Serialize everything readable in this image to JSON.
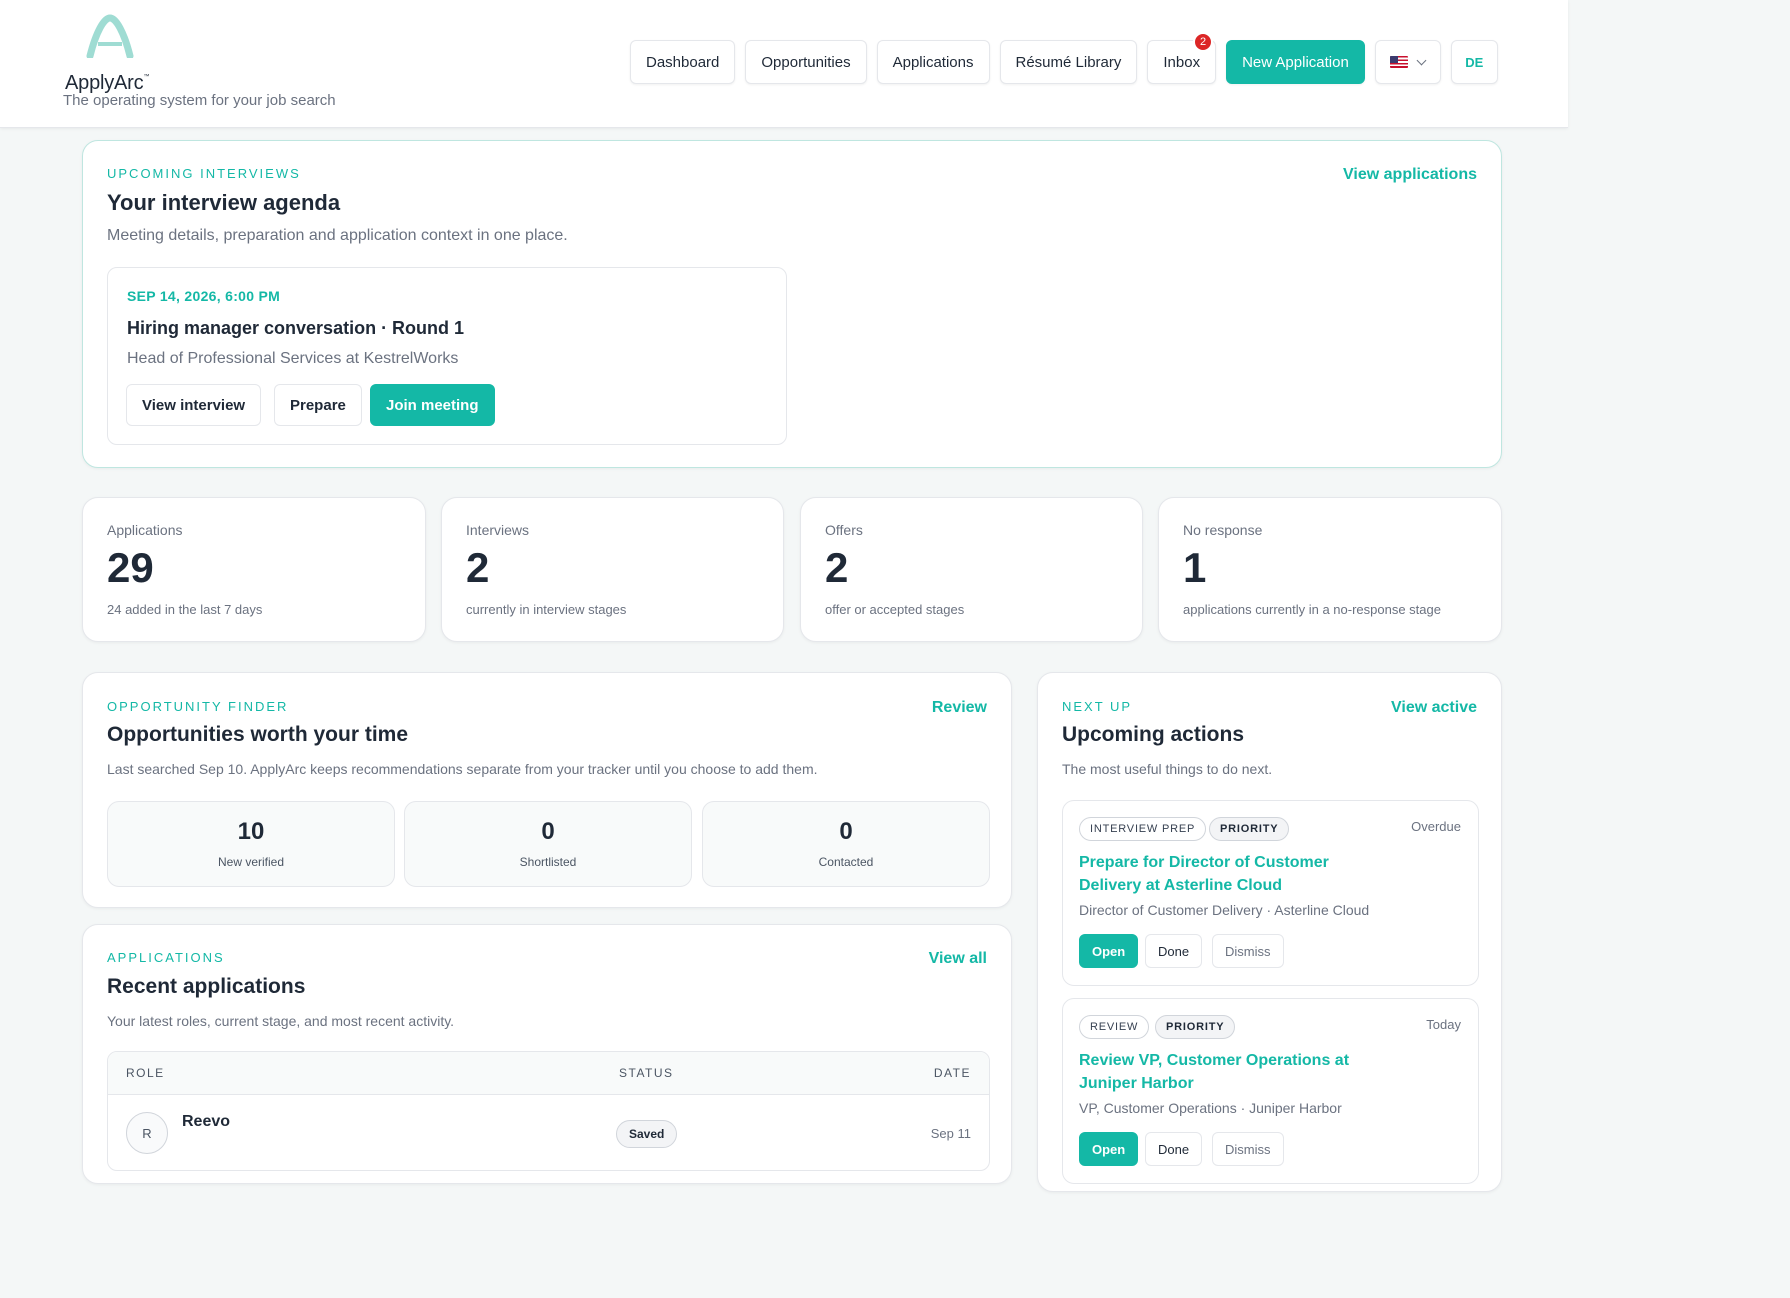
{
  "brand": {
    "name": "ApplyArc",
    "tm": "™",
    "tagline": "The operating system for your job search"
  },
  "nav": {
    "dashboard": "Dashboard",
    "opportunities": "Opportunities",
    "applications": "Applications",
    "resume_library": "Résumé Library",
    "inbox": "Inbox",
    "inbox_count": "2",
    "new_application": "New Application",
    "language_flag": "flag-us-icon",
    "avatar_initials": "DE"
  },
  "interviews": {
    "eyebrow": "UPCOMING INTERVIEWS",
    "title": "Your interview agenda",
    "subtitle": "Meeting details, preparation and application context in one place.",
    "link": "View applications",
    "item": {
      "datetime": "SEP 14, 2026, 6:00 PM",
      "title": "Hiring manager conversation · Round 1",
      "subtitle": "Head of Professional Services at KestrelWorks",
      "view_label": "View interview",
      "prepare_label": "Prepare",
      "join_label": "Join meeting"
    }
  },
  "stats": [
    {
      "label": "Applications",
      "value": "29",
      "note": "24 added in the last 7 days"
    },
    {
      "label": "Interviews",
      "value": "2",
      "note": "currently in interview stages"
    },
    {
      "label": "Offers",
      "value": "2",
      "note": "offer or accepted stages"
    },
    {
      "label": "No response",
      "value": "1",
      "note": "applications currently in a no-response stage"
    }
  ],
  "finder": {
    "eyebrow": "OPPORTUNITY FINDER",
    "title": "Opportunities worth your time",
    "subtitle": "Last searched Sep 10. ApplyArc keeps recommendations separate from your tracker until you choose to add them.",
    "link": "Review",
    "metrics": [
      {
        "value": "10",
        "label": "New verified"
      },
      {
        "value": "0",
        "label": "Shortlisted"
      },
      {
        "value": "0",
        "label": "Contacted"
      }
    ]
  },
  "next_up": {
    "eyebrow": "NEXT UP",
    "title": "Upcoming actions",
    "subtitle": "The most useful things to do next.",
    "link": "View active",
    "actions": [
      {
        "tag": "INTERVIEW PREP",
        "priority": "PRIORITY",
        "due": "Overdue",
        "title": "Prepare for Director of Customer Delivery at Asterline Cloud",
        "subtitle": "Director of Customer Delivery · Asterline Cloud",
        "open": "Open",
        "done": "Done",
        "dismiss": "Dismiss"
      },
      {
        "tag": "REVIEW",
        "priority": "PRIORITY",
        "due": "Today",
        "title": "Review VP, Customer Operations at Juniper Harbor",
        "subtitle": "VP, Customer Operations · Juniper Harbor",
        "open": "Open",
        "done": "Done",
        "dismiss": "Dismiss"
      }
    ]
  },
  "recent": {
    "eyebrow": "APPLICATIONS",
    "title": "Recent applications",
    "subtitle": "Your latest roles, current stage, and most recent activity.",
    "link": "View all",
    "columns": {
      "role": "ROLE",
      "status": "STATUS",
      "date": "DATE"
    },
    "rows": [
      {
        "initial": "R",
        "company": "Reevo",
        "status": "Saved",
        "date": "Sep 11"
      }
    ]
  },
  "colors": {
    "accent": "#14b8a6",
    "badge": "#dc2626"
  }
}
